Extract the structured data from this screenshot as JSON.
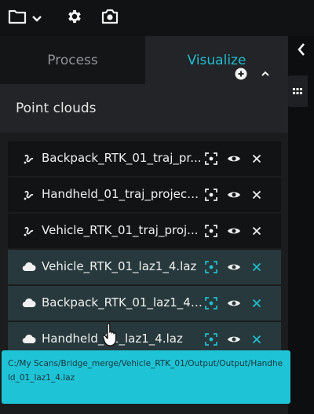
{
  "toolbar": {
    "icons": [
      "folder-icon",
      "chevron-down-icon",
      "gear-icon",
      "camera-icon"
    ]
  },
  "tabs": [
    {
      "label": "Process",
      "active": false
    },
    {
      "label": "Visualize",
      "active": true
    }
  ],
  "section": {
    "title": "Point clouds"
  },
  "point_clouds": [
    {
      "label": "Backpack_RTK_01_traj_pr...",
      "type": "trajectory",
      "style": "dark"
    },
    {
      "label": "Handheld_01_traj_project...",
      "type": "trajectory",
      "style": "dark"
    },
    {
      "label": "Vehicle_RTK_01_traj_proj...",
      "type": "trajectory",
      "style": "dark"
    },
    {
      "label": "Vehicle_RTK_01_laz1_4.laz",
      "type": "cloud",
      "style": "teal"
    },
    {
      "label": "Backpack_RTK_01_laz1_4....",
      "type": "cloud",
      "style": "teal"
    },
    {
      "label": "Handheld_01_laz1_4.laz",
      "type": "cloud",
      "style": "teal"
    }
  ],
  "tooltip": {
    "text": "C:/My Scans/Bridge_merge/Vehicle_RTK_01/Output/Output/Handheld_01_laz1_4.laz"
  },
  "colors": {
    "accent": "#21bdd0",
    "panel": "#1b1c1e",
    "row_dark": "#121315",
    "row_teal": "#27393c",
    "tooltip_bg": "#1fc3d6",
    "viewport_line": "#d8d23a"
  }
}
